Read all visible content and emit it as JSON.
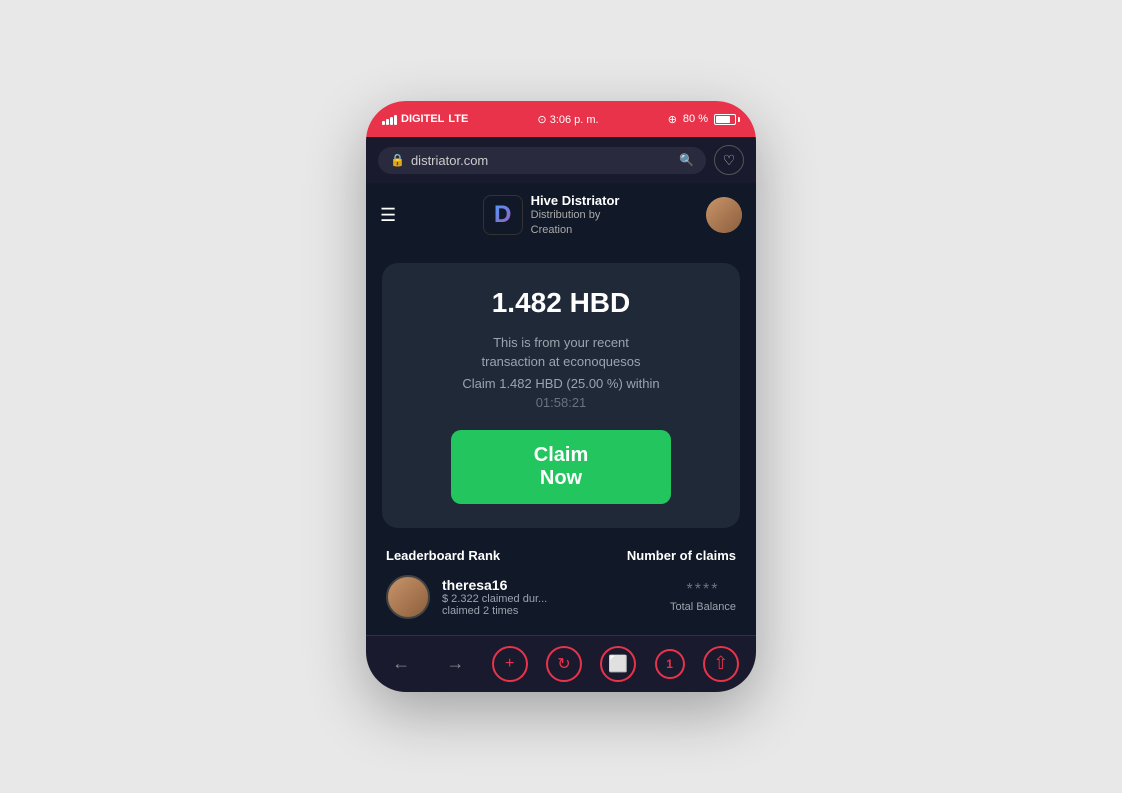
{
  "statusBar": {
    "carrier": "DIGITEL",
    "network": "LTE",
    "time": "3:06 p. m.",
    "battery": "80 %"
  },
  "browserBar": {
    "url": "distriator.com",
    "urlIcon": "🔒"
  },
  "appHeader": {
    "siteName": "Hive Distriator",
    "subtitle1": "Distribution by",
    "subtitle2": "Creation"
  },
  "claimCard": {
    "amount": "1.482 HBD",
    "description1": "This is from your recent",
    "description2": "transaction at econoquesos",
    "claimDetail": "Claim 1.482 HBD (25.00 %) within",
    "timer": "01:58:21",
    "claimButtonLabel": "Claim Now"
  },
  "leaderboard": {
    "rankLabel": "Leaderboard Rank",
    "claimsLabel": "Number of claims",
    "user": {
      "username": "theresa16",
      "claimedAmount": "$ 2.322 claimed dur...",
      "claimedTimes": "claimed 2 times",
      "stars": "****",
      "totalBalanceLabel": "Total Balance"
    }
  },
  "browserNav": {
    "back": "←",
    "forward": "→",
    "add": "+",
    "refresh": "↻",
    "tab": "⬜",
    "badge": "1",
    "share": "↑"
  }
}
